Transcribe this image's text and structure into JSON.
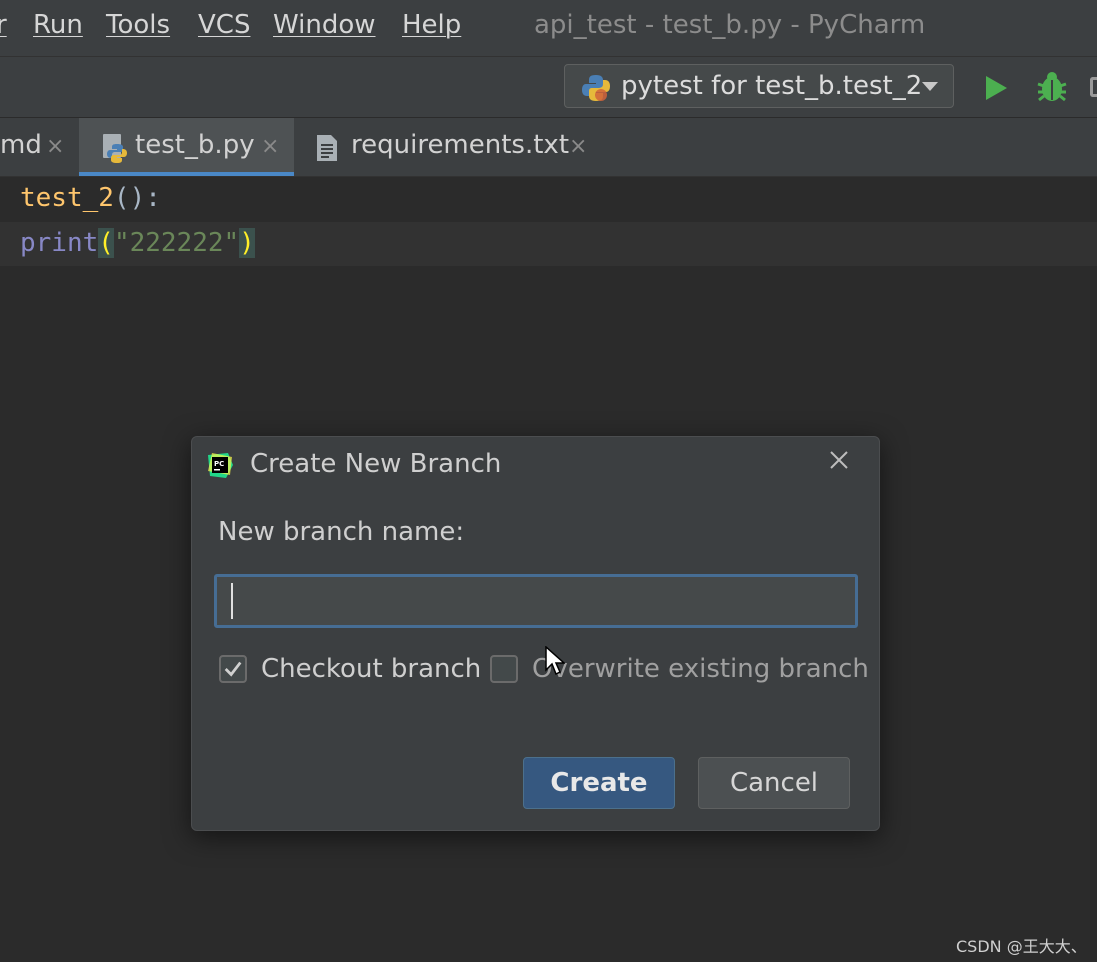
{
  "menubar": {
    "items": [
      {
        "label": "r"
      },
      {
        "label": "Run"
      },
      {
        "label": "Tools"
      },
      {
        "label": "VCS"
      },
      {
        "label": "Window"
      },
      {
        "label": "Help"
      }
    ],
    "window_title": "api_test - test_b.py - PyCharm"
  },
  "toolbar": {
    "run_config_label": "pytest for test_b.test_2",
    "run_color": "#4caf50",
    "debug_color": "#4caf50"
  },
  "tabs": [
    {
      "label": "md",
      "close": "×",
      "active": false
    },
    {
      "label": "test_b.py",
      "close": "×",
      "active": true,
      "icon": "python-file-icon"
    },
    {
      "label": "requirements.txt",
      "close": "×",
      "active": false,
      "icon": "text-file-icon"
    }
  ],
  "editor": {
    "line1": {
      "name": "test_2",
      "rest": "():"
    },
    "line2": {
      "builtin": "print",
      "open": "(",
      "string": "\"222222\"",
      "close": ")"
    }
  },
  "dialog": {
    "title": "Create New Branch",
    "field_label": "New branch name:",
    "input_value": "",
    "checkout": {
      "label": "Checkout branch",
      "checked": true
    },
    "overwrite": {
      "label": "Overwrite existing branch",
      "checked": false
    },
    "create_label": "Create",
    "cancel_label": "Cancel",
    "accent_color": "#365880"
  },
  "watermark": "CSDN @王大大、"
}
